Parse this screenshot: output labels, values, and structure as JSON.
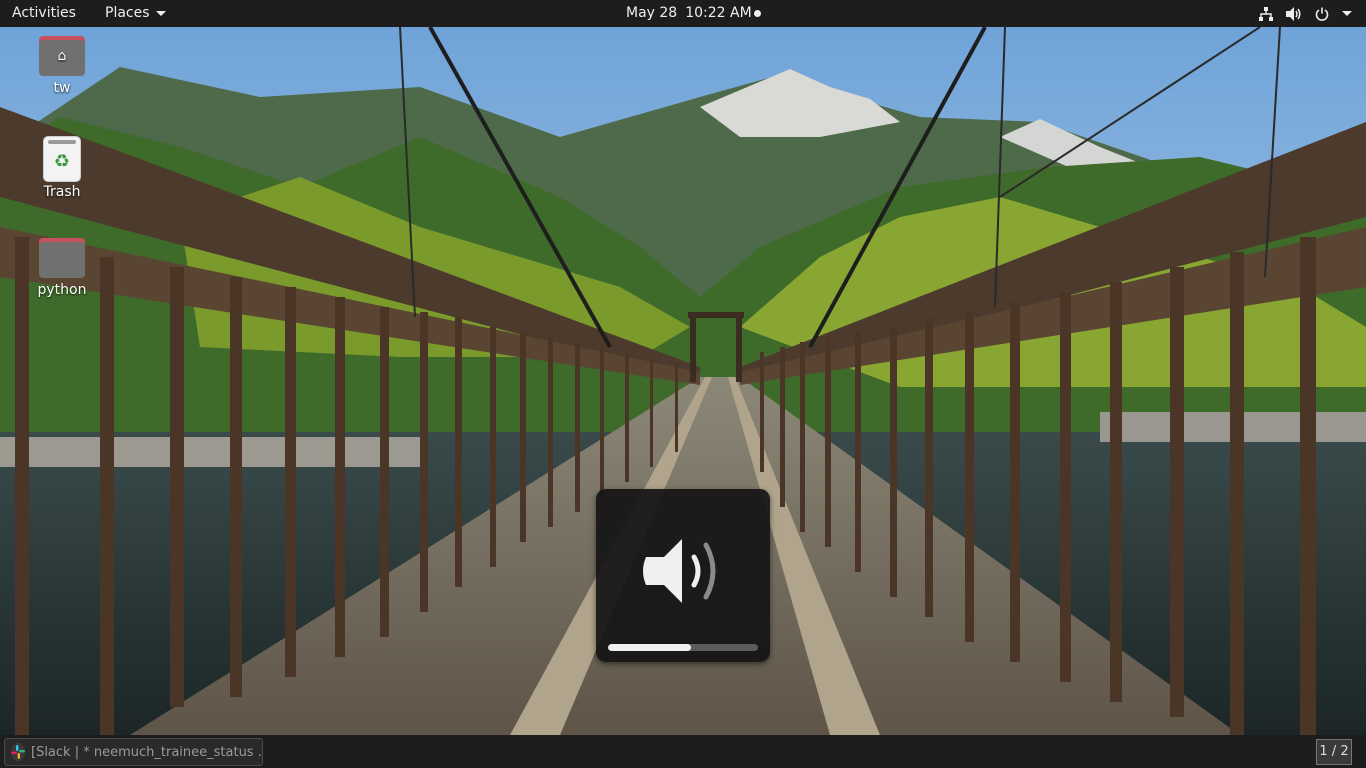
{
  "topbar": {
    "activities": "Activities",
    "places": "Places",
    "date": "May 28",
    "time": "10:22 AM",
    "icons": [
      "network-icon",
      "volume-icon",
      "power-icon",
      "system-menu-arrow-icon"
    ]
  },
  "desktop": {
    "icons": [
      {
        "label": "tw",
        "icon": "home-folder-icon"
      },
      {
        "label": "Trash",
        "icon": "trash-icon"
      },
      {
        "label": "python",
        "icon": "folder-icon"
      }
    ]
  },
  "osd": {
    "icon": "volume-medium-icon",
    "level": 0.55
  },
  "taskbar": {
    "window_title": "[Slack | * neemuch_trainee_status ...",
    "workspace": "1 / 2"
  },
  "colors": {
    "panel": "#1d1d1d",
    "folder_tab": "#c7515f",
    "folder_body": "#707070",
    "osd_fill": "#f0f0f0"
  }
}
